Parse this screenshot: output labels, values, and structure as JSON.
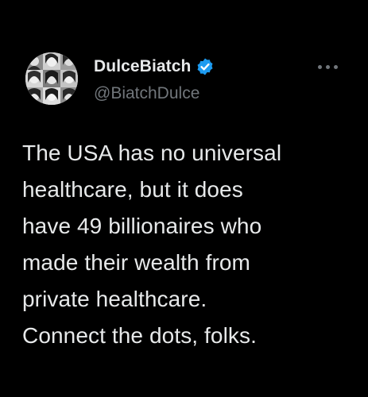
{
  "tweet": {
    "author": {
      "display_name": "DulceBiatch",
      "handle": "@BiatchDulce",
      "verified": true,
      "avatar_icon": "profile-collage-avatar"
    },
    "text": "The USA has no universal\nhealthcare, but it does\nhave 49 billionaires who\nmade their wealth from\nprivate healthcare.\nConnect the dots, folks.",
    "more_icon": "ellipsis-icon"
  },
  "colors": {
    "background": "#000000",
    "primary_text": "#e7e9ea",
    "secondary_text": "#71767b",
    "verified_badge": "#1d9bf0"
  }
}
